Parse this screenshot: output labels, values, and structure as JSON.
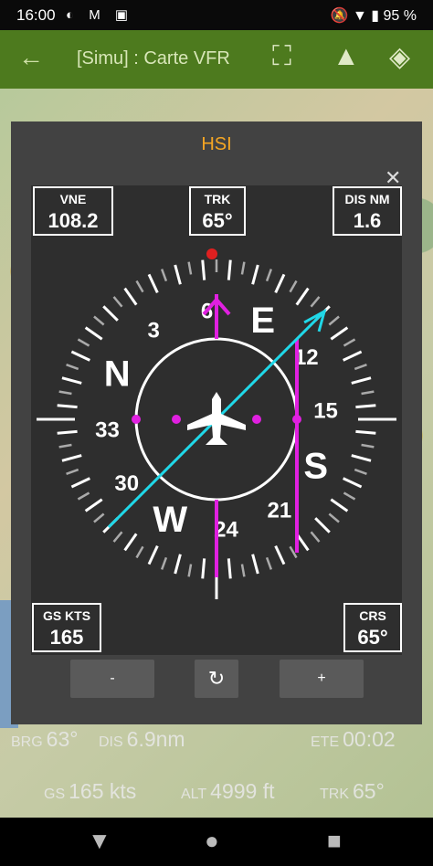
{
  "status": {
    "time": "16:00",
    "battery": "95 %"
  },
  "appbar": {
    "title": "[Simu] : Carte VFR"
  },
  "icons": {
    "back": "arrow-left-icon",
    "fullscreen": "fullscreen-icon",
    "nav": "navigation-arrow-icon",
    "layers": "layers-icon"
  },
  "dialog": {
    "title": "HSI"
  },
  "boxes": {
    "vne": {
      "label": "VNE",
      "value": "108.2"
    },
    "trk": {
      "label": "TRK",
      "value": "65°"
    },
    "dis": {
      "label": "DIS NM",
      "value": "1.6"
    },
    "gs": {
      "label": "GS KTS",
      "value": "165"
    },
    "crs": {
      "label": "CRS",
      "value": "65°"
    }
  },
  "compass": {
    "cardinals": [
      "N",
      "E",
      "S",
      "W"
    ],
    "numbers": [
      "3",
      "6",
      "12",
      "15",
      "21",
      "24",
      "30",
      "33"
    ],
    "heading": 65,
    "course": 65,
    "colors": {
      "needle": "#e020e0",
      "course": "#20d8e8",
      "marker": "#e02020"
    }
  },
  "buttons": {
    "minus": "-",
    "plus": "+"
  },
  "info": {
    "brg_label": "BRG",
    "brg": "63°",
    "dis_label": "DIS",
    "dis": "6.9nm",
    "ete_label": "ETE",
    "ete": "00:02",
    "gs_label": "GS",
    "gs": "165 kts",
    "alt_label": "ALT",
    "alt": "4999 ft",
    "trk_label": "TRK",
    "trk": "65°"
  }
}
